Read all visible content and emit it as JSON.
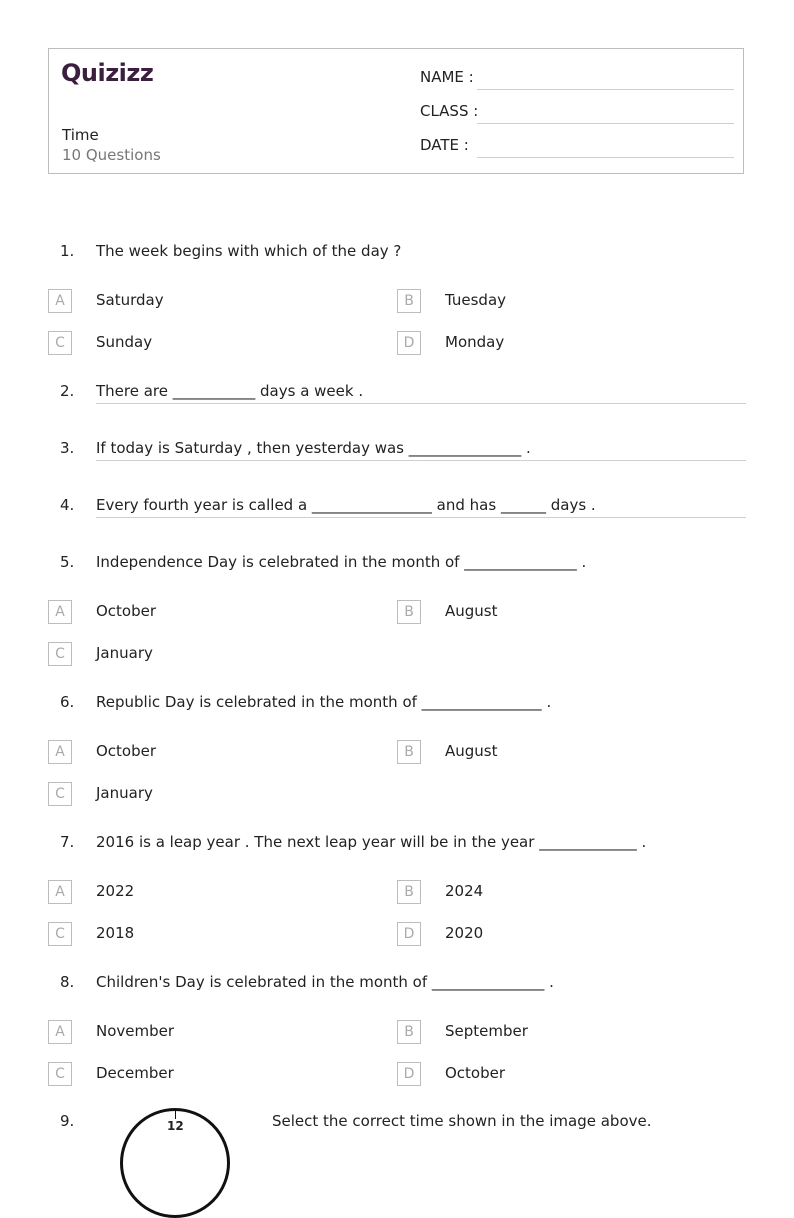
{
  "header": {
    "logo": "Quizizz",
    "title": "Time",
    "question_count": "10 Questions",
    "fields": [
      {
        "label": "NAME :"
      },
      {
        "label": "CLASS :"
      },
      {
        "label": "DATE  :"
      }
    ]
  },
  "questions": [
    {
      "num": "1.",
      "text": "The week begins with which of the day ?",
      "options": [
        {
          "letter": "A",
          "text": "Saturday"
        },
        {
          "letter": "B",
          "text": "Tuesday"
        },
        {
          "letter": "C",
          "text": "Sunday"
        },
        {
          "letter": "D",
          "text": "Monday"
        }
      ]
    },
    {
      "num": "2.",
      "text": "There are ___________ days a week ."
    },
    {
      "num": "3.",
      "text": "If today is Saturday , then yesterday was _______________ ."
    },
    {
      "num": "4.",
      "text": "Every fourth year is called a ________________ and has ______ days ."
    },
    {
      "num": "5.",
      "text": "Independence Day is celebrated in the month of _______________ .",
      "options": [
        {
          "letter": "A",
          "text": "October"
        },
        {
          "letter": "B",
          "text": "August"
        },
        {
          "letter": "C",
          "text": "January"
        }
      ]
    },
    {
      "num": "6.",
      "text": "Republic Day is celebrated in the month of ________________ .",
      "options": [
        {
          "letter": "A",
          "text": "October"
        },
        {
          "letter": "B",
          "text": "August"
        },
        {
          "letter": "C",
          "text": "January"
        }
      ]
    },
    {
      "num": "7.",
      "text": "2016 is a leap year . The next leap year will be in the year _____________ .",
      "options": [
        {
          "letter": "A",
          "text": "2022"
        },
        {
          "letter": "B",
          "text": "2024"
        },
        {
          "letter": "C",
          "text": "2018"
        },
        {
          "letter": "D",
          "text": "2020"
        }
      ]
    },
    {
      "num": "8.",
      "text": "Children's Day is celebrated in the month of _______________ .",
      "options": [
        {
          "letter": "A",
          "text": "November"
        },
        {
          "letter": "B",
          "text": "September"
        },
        {
          "letter": "C",
          "text": "December"
        },
        {
          "letter": "D",
          "text": "October"
        }
      ]
    },
    {
      "num": "9.",
      "text": "Select the correct time shown in the image above.",
      "clock_label": "12"
    }
  ]
}
